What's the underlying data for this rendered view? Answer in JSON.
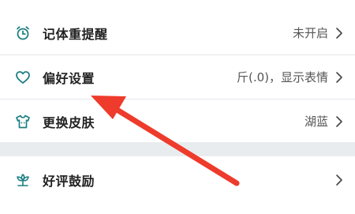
{
  "settings": {
    "rows": [
      {
        "label": "记体重提醒",
        "value": "未开启",
        "icon": "alarm-clock-icon"
      },
      {
        "label": "偏好设置",
        "value": "斤(.0)，显示表情",
        "icon": "heart-icon"
      },
      {
        "label": "更换皮肤",
        "value": "湖蓝",
        "icon": "shirt-icon"
      }
    ],
    "bottom_rows": [
      {
        "label": "好评鼓励",
        "value": "",
        "icon": "flower-icon"
      }
    ]
  },
  "colors": {
    "accent": "#1e7f82",
    "arrow": "#ee3b2b",
    "divider_band": "#e9ecef"
  }
}
